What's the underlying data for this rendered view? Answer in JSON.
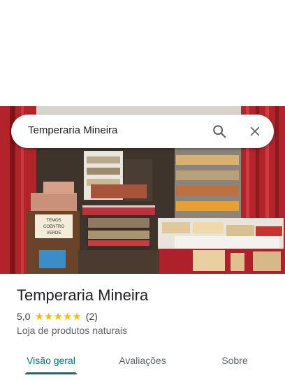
{
  "search": {
    "query": "Temperaria Mineira",
    "search_icon": "search-icon",
    "close_icon": "close-icon"
  },
  "photo": {
    "sign_text": "TEMOS COENTRO VERDE"
  },
  "place": {
    "name": "Temperaria Mineira",
    "rating": "5,0",
    "rating_value": 5,
    "review_count": "(2)",
    "category": "Loja de produtos naturais"
  },
  "tabs": [
    {
      "label": "Visão geral",
      "active": true
    },
    {
      "label": "Avaliações",
      "active": false
    },
    {
      "label": "Sobre",
      "active": false
    }
  ],
  "colors": {
    "accent": "#00737b",
    "star": "#fbbc04"
  }
}
